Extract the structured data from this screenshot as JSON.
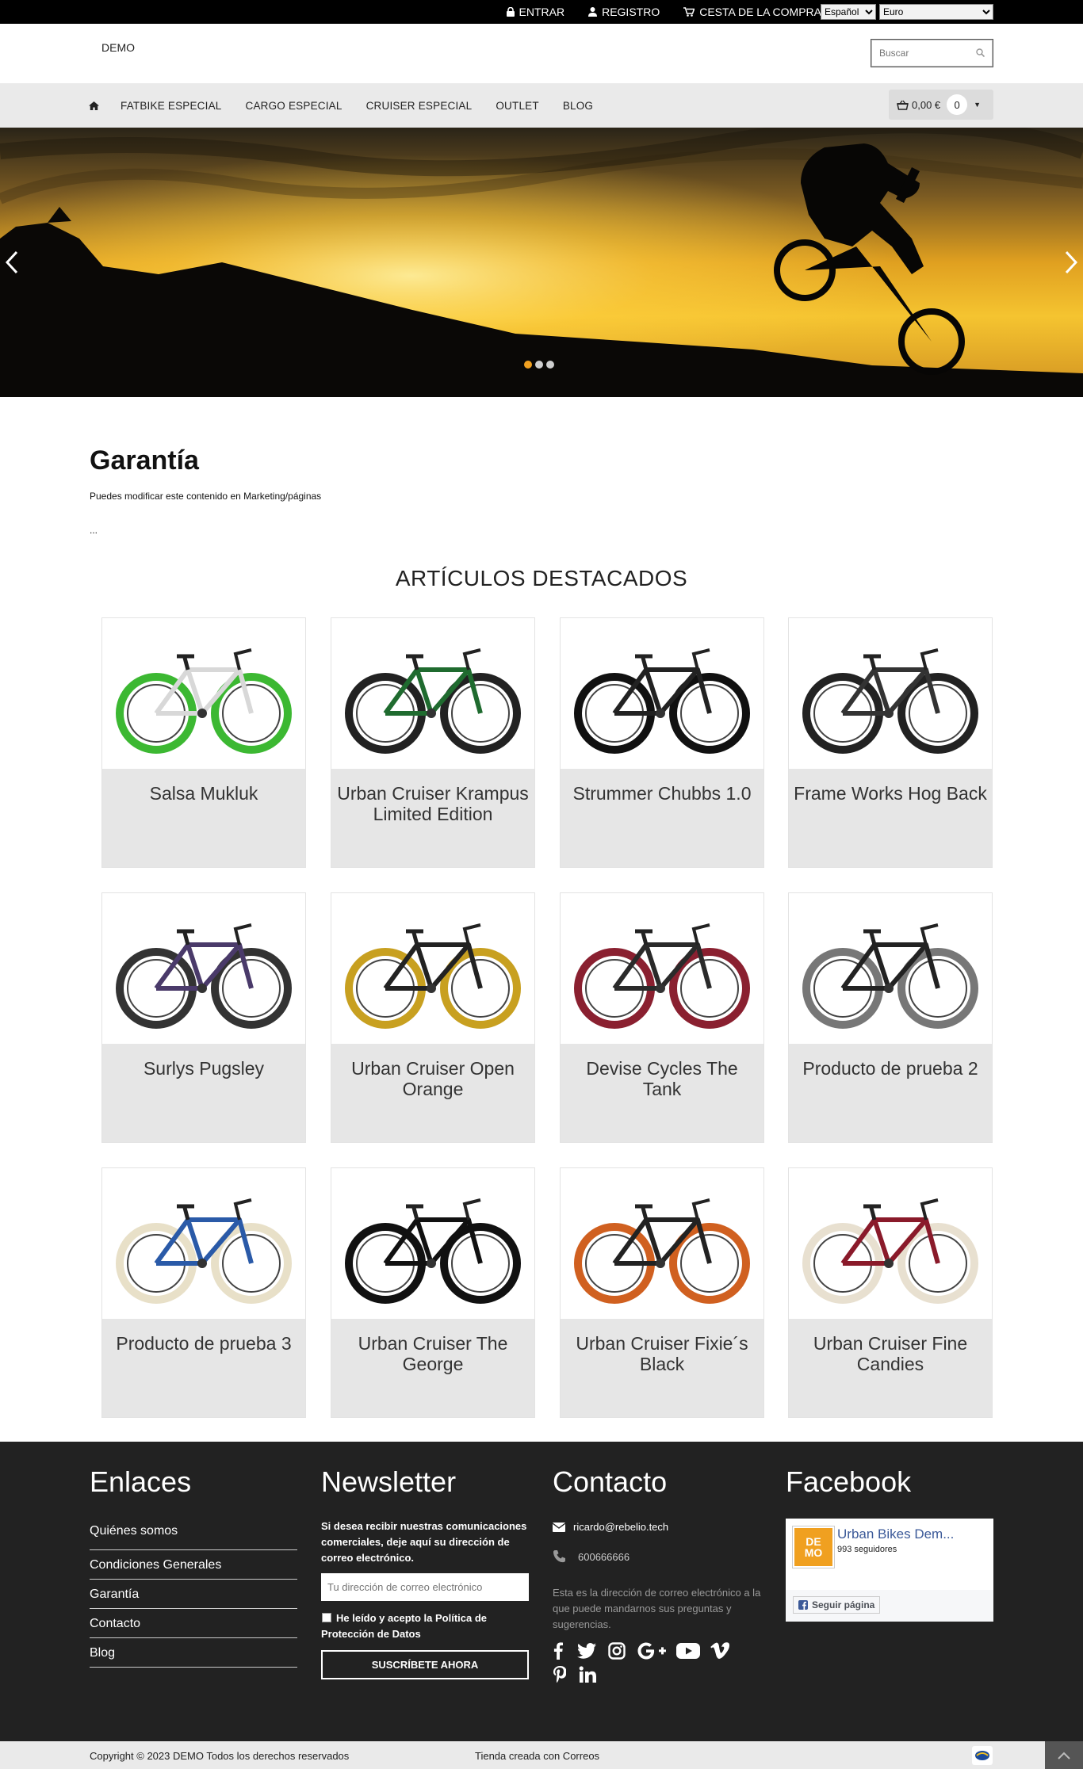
{
  "topbar": {
    "login": "ENTRAR",
    "register": "REGISTRO",
    "cart": "CESTA DE LA COMPRA",
    "language": "Español",
    "currency": "Euro"
  },
  "header": {
    "logo": "DEMO",
    "search_placeholder": "Buscar"
  },
  "nav": {
    "items": [
      "FATBIKE ESPECIAL",
      "CARGO ESPECIAL",
      "CRUISER ESPECIAL",
      "OUTLET",
      "BLOG"
    ],
    "cart_amount": "0,00 €",
    "cart_count": "0"
  },
  "hero": {
    "active_slide": 1,
    "slides": 3
  },
  "page": {
    "title": "Garantía",
    "description": "Puedes modificar este contenido en Marketing/páginas",
    "more": "..."
  },
  "featured": {
    "title": "ARTÍCULOS DESTACADOS",
    "products": [
      {
        "name": "Salsa Mukluk",
        "frame": "#d8d8d8",
        "wheel": "#3cb832"
      },
      {
        "name": "Urban Cruiser Krampus Limited Edition",
        "frame": "#1f6b2f",
        "wheel": "#222222"
      },
      {
        "name": "Strummer Chubbs 1.0",
        "frame": "#222222",
        "wheel": "#111111"
      },
      {
        "name": "Frame Works Hog Back",
        "frame": "#333333",
        "wheel": "#222222"
      },
      {
        "name": "Surlys Pugsley",
        "frame": "#4a3a6a",
        "wheel": "#333333"
      },
      {
        "name": "Urban Cruiser Open Orange",
        "frame": "#222222",
        "wheel": "#c8a020"
      },
      {
        "name": "Devise Cycles The Tank",
        "frame": "#2a2a2a",
        "wheel": "#8a2030"
      },
      {
        "name": "Producto de prueba 2",
        "frame": "#222222",
        "wheel": "#777777"
      },
      {
        "name": "Producto de prueba 3",
        "frame": "#2a5aa8",
        "wheel": "#e8e0c8"
      },
      {
        "name": "Urban Cruiser The George",
        "frame": "#111111",
        "wheel": "#111111"
      },
      {
        "name": "Urban Cruiser Fixie´s Black",
        "frame": "#222222",
        "wheel": "#d06020"
      },
      {
        "name": "Urban Cruiser Fine Candies",
        "frame": "#8a1a2a",
        "wheel": "#e8e0d0"
      }
    ]
  },
  "footer": {
    "links_title": "Enlaces",
    "links": [
      "Quiénes somos",
      "Condiciones Generales",
      "Garantía",
      "Contacto",
      "Blog"
    ],
    "newsletter_title": "Newsletter",
    "newsletter_text": "Si desea recibir nuestras comunicaciones comerciales, deje aquí su dirección de correo electrónico.",
    "newsletter_placeholder": "Tu dirección de correo electrónico",
    "terms_line1": "He leído y acepto la Política de",
    "terms_line2": "Protección de Datos",
    "subscribe": "SUSCRÍBETE AHORA",
    "contact_title": "Contacto",
    "email": "ricardo@rebelio.tech",
    "phone": "600666666",
    "contact_desc": "Esta es la dirección de correo electrónico a la que puede mandarnos sus preguntas y sugerencias.",
    "facebook_title": "Facebook",
    "fb_page_name": "Urban Bikes Dem...",
    "fb_followers": "993 seguidores",
    "fb_follow": "Seguir página",
    "fb_logo_line1": "DE",
    "fb_logo_line2": "MO"
  },
  "bottom": {
    "copyright": "Copyright © 2023 DEMO Todos los derechos reservados",
    "store": "Tienda creada con Correos"
  },
  "colors": {
    "accent": "#f0a020",
    "footer_bg": "#222222",
    "nav_bg": "#eaeaea"
  }
}
